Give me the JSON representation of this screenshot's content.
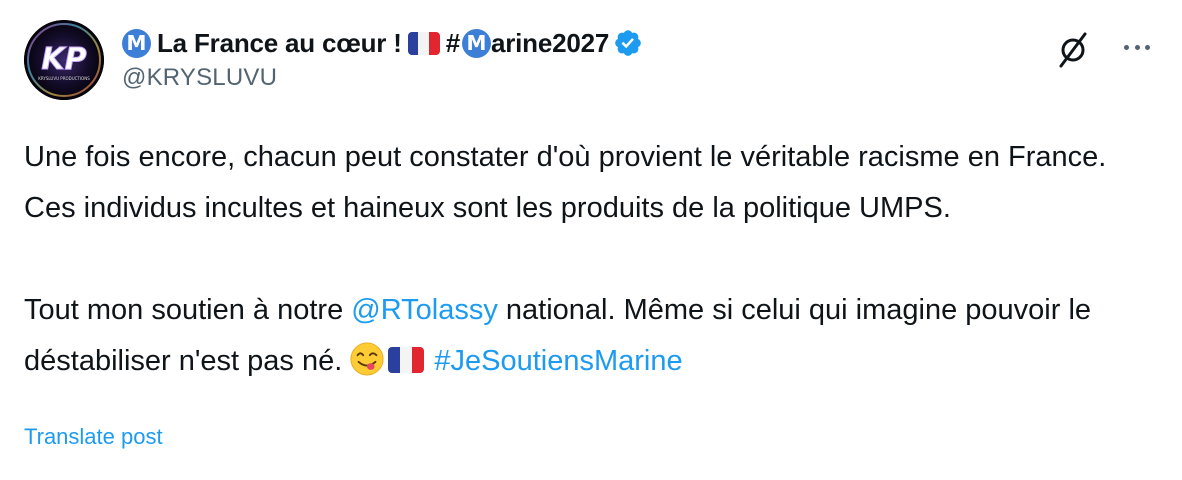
{
  "author": {
    "avatar_initials": "KP",
    "avatar_caption": "KRYSLUVU PRODUCTIONS",
    "name_badge_letter": "M",
    "name_part1": "La France au cœur !",
    "name_hash": "#",
    "name_part2": "arine2027",
    "handle": "@KRYSLUVU",
    "verified": true
  },
  "header_actions": {
    "grok_icon": "slashed-circle-icon",
    "more_icon": "more-dots-icon"
  },
  "post": {
    "paragraph1": "Une fois encore, chacun peut constater d'où provient le véritable racisme en France. Ces individus incultes et haineux sont les produits de la politique UMPS.",
    "p2_text1": "Tout mon soutien à notre ",
    "p2_mention": "@RTolassy",
    "p2_text2": " national. Même si celui qui imagine pouvoir le déstabiliser n'est pas né. ",
    "p2_hashtag": "#JeSoutiensMarine",
    "emoji": "face-savoring-food-emoji",
    "flag": "france-flag"
  },
  "translate_label": "Translate post",
  "colors": {
    "link": "#1d9bf0",
    "text": "#0f1419",
    "muted": "#536471",
    "badge": "#3d7fd6"
  }
}
